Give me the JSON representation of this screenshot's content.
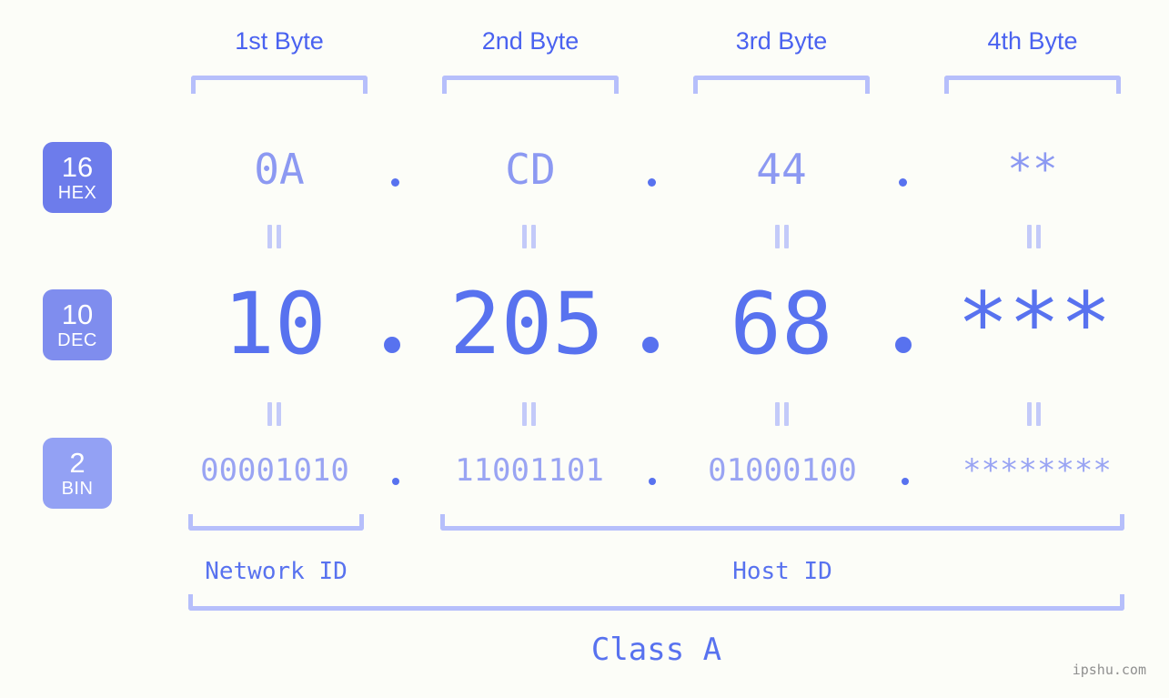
{
  "page": {
    "background": "#fcfdf8",
    "accent": "#5872ef",
    "accent_light": "#b6bffb",
    "watermark": "ipshu.com"
  },
  "headers": [
    {
      "label": "1st Byte"
    },
    {
      "label": "2nd Byte"
    },
    {
      "label": "3rd Byte"
    },
    {
      "label": "4th Byte"
    }
  ],
  "radix_badges": [
    {
      "base": "16",
      "name": "HEX",
      "color": "#6d7ceb"
    },
    {
      "base": "10",
      "name": "DEC",
      "color": "#7f8dee"
    },
    {
      "base": "2",
      "name": "BIN",
      "color": "#93a1f4"
    }
  ],
  "rows": {
    "hex": {
      "values": [
        "0A",
        "CD",
        "44",
        "**"
      ]
    },
    "dec": {
      "values": [
        "10",
        "205",
        "68",
        "***"
      ]
    },
    "bin": {
      "values": [
        "00001010",
        "11001101",
        "01000100",
        "********"
      ]
    }
  },
  "separators": {
    "dot": "."
  },
  "equals": {
    "symbol": "="
  },
  "segments": {
    "network_id": "Network ID",
    "host_id": "Host ID",
    "class": "Class A"
  }
}
